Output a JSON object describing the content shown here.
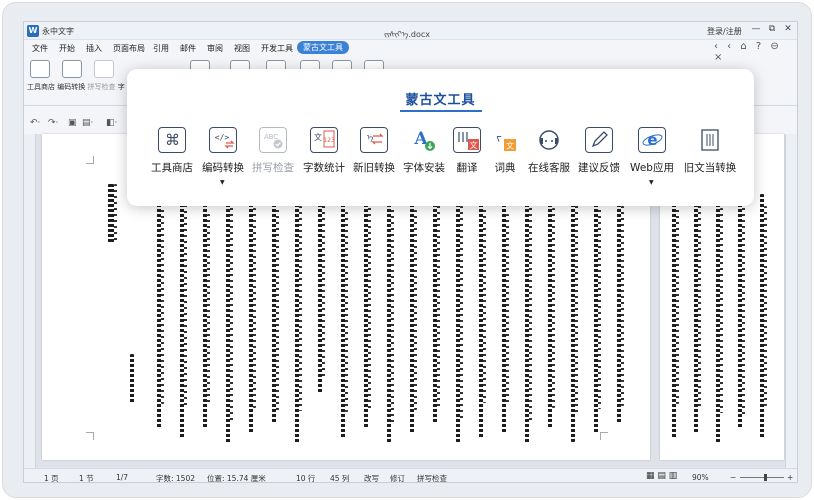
{
  "titlebar": {
    "logo": "W",
    "app_name": "永中文字",
    "document": "ᠵᠢᠰᠢᠶ᠎ᠡ.docx",
    "login": "登录/注册",
    "minimize": "—",
    "restore": "⧉",
    "close": "✕"
  },
  "menu": {
    "items": [
      "文件",
      "开始",
      "插入",
      "页面布局",
      "引用",
      "邮件",
      "审阅",
      "视图",
      "开发工具",
      "蒙古文工具"
    ],
    "active_index": 9,
    "quick_icons": "‹ ‹ ⌂ ? ⊖ ×"
  },
  "ribbon": {
    "label_store": "工具商店",
    "label_encode": "编码转换",
    "label_spell": "拼写检查",
    "label_count": "字"
  },
  "popup": {
    "title": "蒙古文工具",
    "tools": [
      {
        "name": "工具商店",
        "icon": "command-icon",
        "disabled": false,
        "dropdown": false
      },
      {
        "name": "编码转换",
        "icon": "code-convert-icon",
        "disabled": false,
        "dropdown": true
      },
      {
        "name": "拼写检查",
        "icon": "spell-check-icon",
        "disabled": true,
        "dropdown": false
      },
      {
        "name": "字数统计",
        "icon": "word-count-icon",
        "disabled": false,
        "dropdown": false
      },
      {
        "name": "新旧转换",
        "icon": "old-new-convert-icon",
        "disabled": false,
        "dropdown": false
      },
      {
        "name": "字体安装",
        "icon": "font-install-icon",
        "disabled": false,
        "dropdown": false
      },
      {
        "name": "翻译",
        "icon": "translate-icon",
        "disabled": false,
        "dropdown": false
      },
      {
        "name": "词典",
        "icon": "dictionary-icon",
        "disabled": false,
        "dropdown": false
      },
      {
        "name": "在线客服",
        "icon": "headset-icon",
        "disabled": false,
        "dropdown": false
      },
      {
        "name": "建议反馈",
        "icon": "pen-feedback-icon",
        "disabled": false,
        "dropdown": false
      },
      {
        "name": "Web应用",
        "icon": "web-app-icon",
        "disabled": false,
        "dropdown": true
      },
      {
        "name": "旧文当转换",
        "icon": "old-document-icon",
        "disabled": false,
        "dropdown": false
      }
    ]
  },
  "statusbar": {
    "page": "1 页",
    "section": "1 节",
    "page_of": "1/7",
    "word_count": "字数: 1502",
    "position": "位置: 15.74 厘米",
    "row": "10 行",
    "column": "45 列",
    "overwrite": "改写",
    "revision": "修订",
    "spell": "拼写检查",
    "zoom": "90%",
    "zoom_minus": "−",
    "zoom_plus": "+"
  },
  "colors": {
    "accent": "#3b82d6",
    "title_blue": "#1c4f9c",
    "translate_red": "#e2574c",
    "dictionary_orange": "#f39c34",
    "font_green": "#3aa655"
  }
}
